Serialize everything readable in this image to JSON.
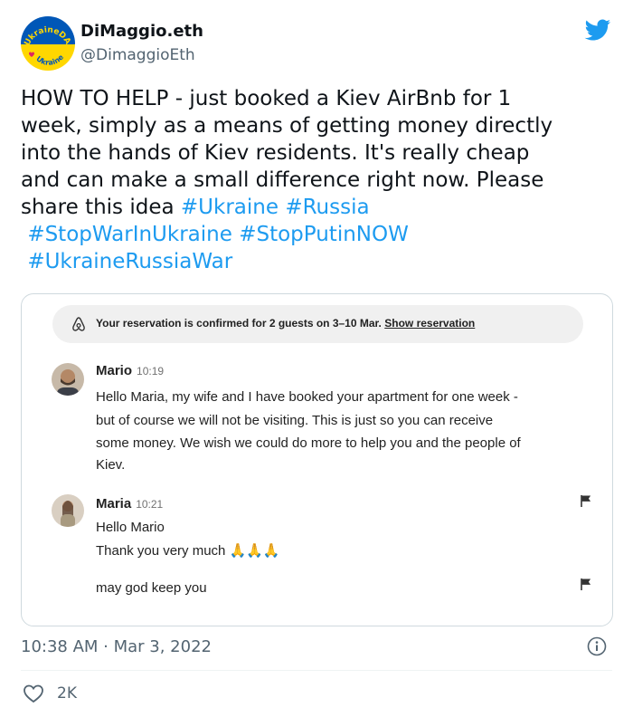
{
  "header": {
    "display_name": "DiMaggio.eth",
    "handle": "@DimaggioEth",
    "avatar_text_top": "UkraineDAO",
    "avatar_text_bottom": "Ukraine"
  },
  "tweet": {
    "lines": [
      [
        {
          "text": "HOW TO HELP - just booked a Kiev AirBnb for 1",
          "tag": false
        }
      ],
      [
        {
          "text": "week, simply as a means of getting money directly",
          "tag": false
        }
      ],
      [
        {
          "text": "into the hands of Kiev residents. It's really cheap",
          "tag": false
        }
      ],
      [
        {
          "text": "and can make a small difference right now. Please",
          "tag": false
        }
      ],
      [
        {
          "text": "share this idea ",
          "tag": false
        },
        {
          "text": "#Ukraine",
          "tag": true
        },
        {
          "text": " ",
          "tag": false
        },
        {
          "text": "#Russia",
          "tag": true
        }
      ],
      [
        {
          "text": " ",
          "tag": false
        },
        {
          "text": "#StopWarInUkraine",
          "tag": true
        },
        {
          "text": " ",
          "tag": false
        },
        {
          "text": "#StopPutinNOW",
          "tag": true
        }
      ],
      [
        {
          "text": " ",
          "tag": false
        },
        {
          "text": "#UkraineRussiaWar",
          "tag": true
        }
      ]
    ]
  },
  "card": {
    "banner_text": "Your reservation is confirmed for 2 guests on 3–10 Mar.",
    "banner_link": "Show reservation",
    "messages": [
      {
        "sender": "Mario",
        "time": "10:19",
        "lines": [
          "Hello Maria, my wife and I have booked your apartment for one week -",
          "but of course we will not be visiting. This is just so you can receive",
          "some money. We wish we could do more to help you and the people of",
          "Kiev."
        ]
      },
      {
        "sender": "Maria",
        "time": "10:21",
        "lines": [
          "Hello Mario",
          "Thank you very much"
        ],
        "emoji": "🙏🙏🙏",
        "followup": "may god keep you"
      }
    ]
  },
  "footer": {
    "timestamp": "10:38 AM · Mar 3, 2022",
    "like_count": "2K"
  },
  "colors": {
    "link": "#1d9bf0",
    "twitter_blue": "#1d9bf0",
    "secondary_text": "#536471",
    "ukraine_blue": "#0057b7",
    "ukraine_yellow": "#ffd700"
  }
}
